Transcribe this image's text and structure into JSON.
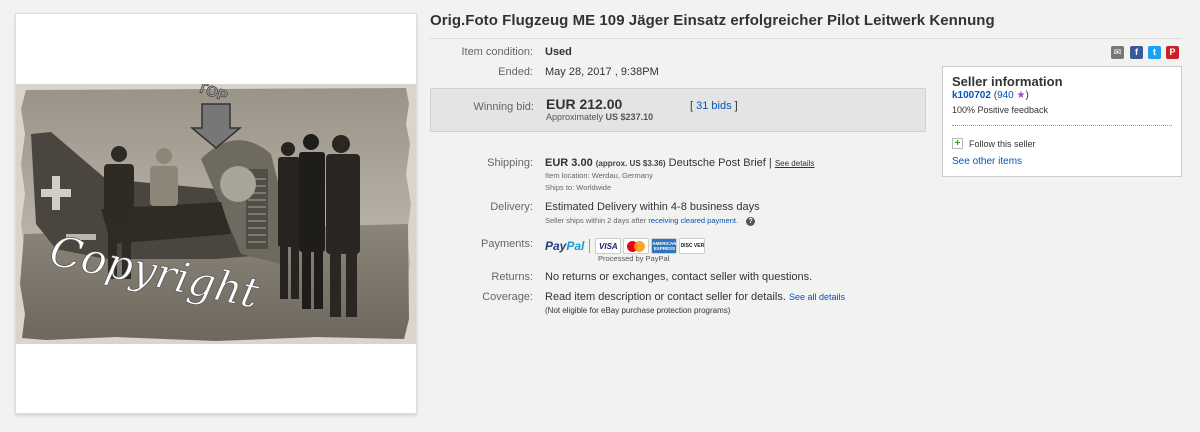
{
  "listing": {
    "title": "Orig.Foto Flugzeug ME 109 Jäger Einsatz erfolgreicher Pilot Leitwerk Kennung"
  },
  "image": {
    "watermark_text": "Copyright",
    "arrow_text": "TOP"
  },
  "details": {
    "condition_label": "Item condition:",
    "condition_value": "Used",
    "ended_label": "Ended:",
    "ended_value": "May 28, 2017 , 9:38PM",
    "winning_bid_label": "Winning bid:",
    "winning_bid_value": "EUR 212.00",
    "approx_prefix": "Approximately",
    "approx_value": "US $237.10",
    "bids_open": "[",
    "bids_text": "31 bids",
    "bids_close": "]",
    "shipping_label": "Shipping:",
    "shipping_cost": "EUR 3.00",
    "shipping_approx": "(approx. US $3.36)",
    "shipping_service": "Deutsche Post Brief",
    "shipping_sep": "|",
    "see_details": "See details",
    "item_location": "Item location:   Werdau, Germany",
    "ships_to": "Ships to:   Worldwide",
    "delivery_label": "Delivery:",
    "delivery_value": "Estimated Delivery within 4-8 business days",
    "delivery_note_prefix": "Seller ships within 2 days after",
    "delivery_note_link": "receiving cleared payment",
    "delivery_note_suffix": ".",
    "payments_label": "Payments:",
    "paypal_a": "Pay",
    "paypal_b": "Pal",
    "processed_by": "Processed by PayPal",
    "returns_label": "Returns:",
    "returns_value": "No returns or exchanges, contact seller with questions.",
    "coverage_label": "Coverage:",
    "coverage_value": "Read item description or contact seller for details.",
    "see_all_details": "See all details",
    "coverage_note": "(Not eligible for eBay purchase protection programs)"
  },
  "payment_cards": {
    "visa": "VISA",
    "amex": "AMERICAN EXPRESS",
    "discover": "DISC VER"
  },
  "seller": {
    "heading": "Seller information",
    "username": "k100702",
    "score_open": "(",
    "score": "940",
    "score_close": ")",
    "feedback": "100% Positive feedback",
    "follow": "Follow this seller",
    "see_other": "See other items"
  },
  "share": {
    "mail": "✉",
    "facebook": "f",
    "twitter": "t",
    "pinterest": "P"
  },
  "colors": {
    "link": "#0654ba",
    "background": "#f2f2f0",
    "bid_box": "#e4e4e4",
    "star": "#9b4dca"
  }
}
